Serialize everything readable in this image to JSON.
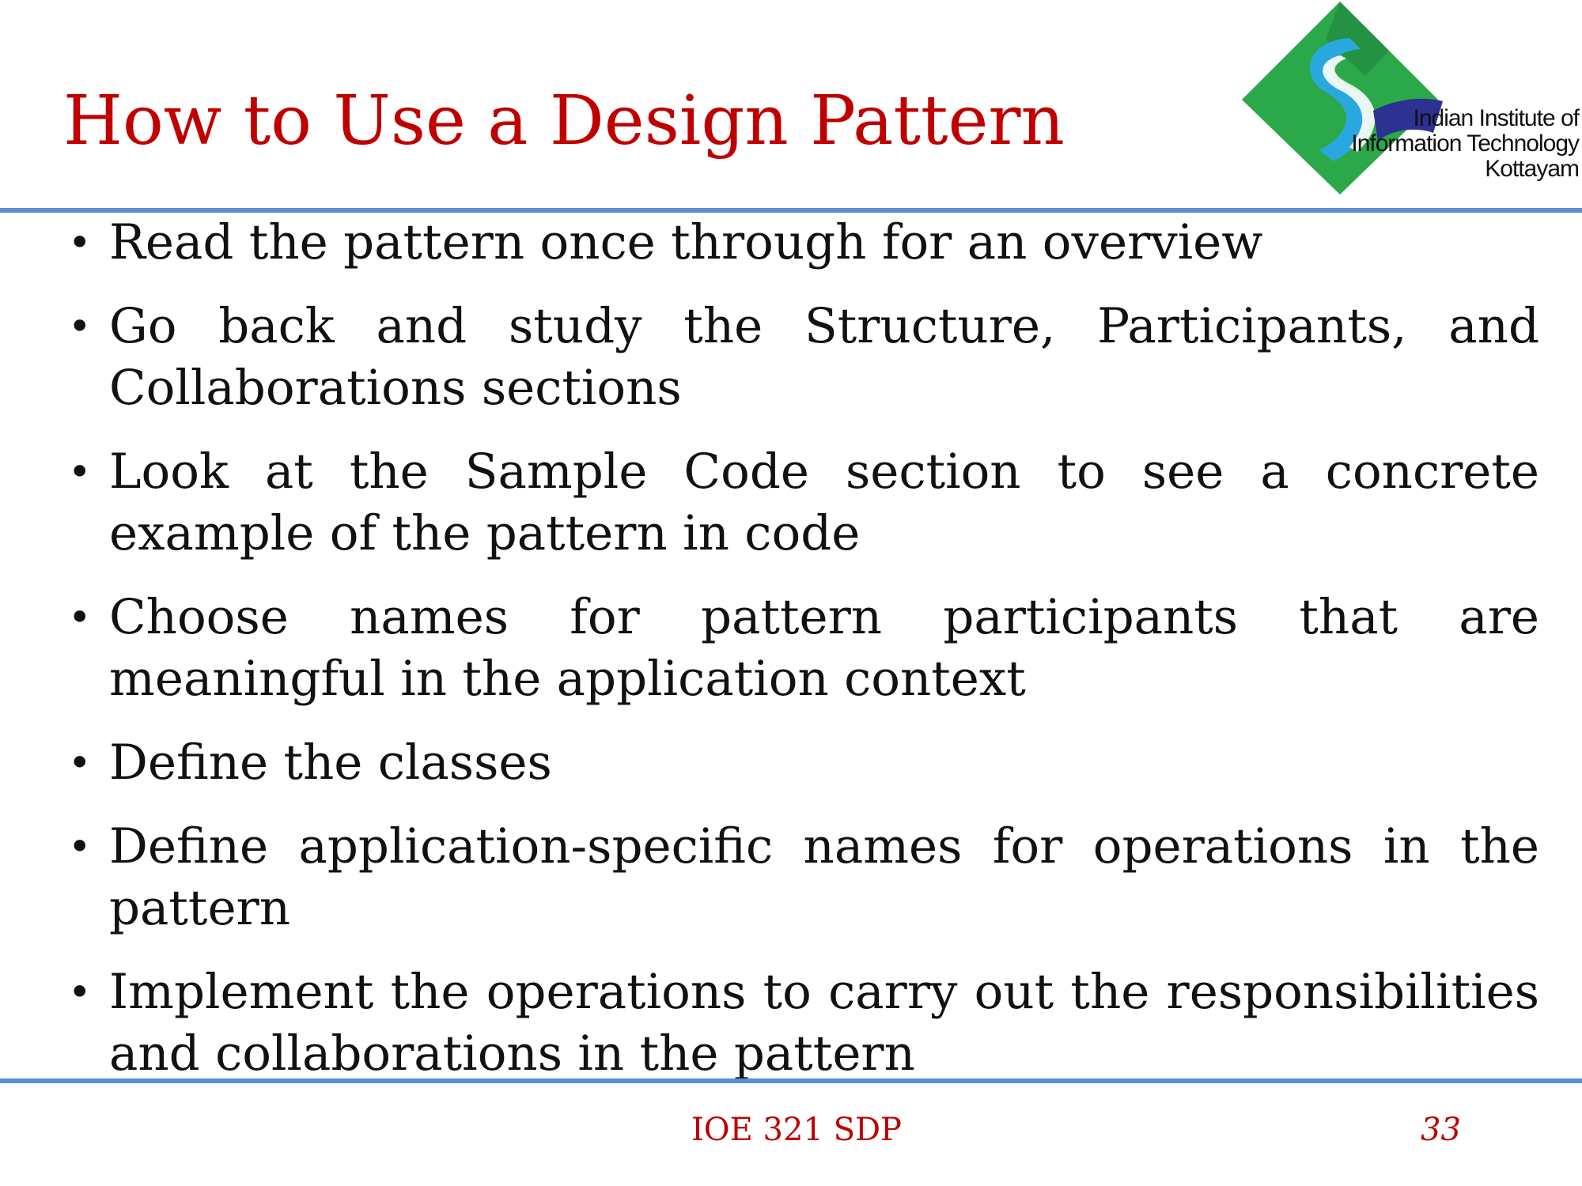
{
  "slide": {
    "title": "How to Use a Design Pattern",
    "logo": {
      "name": "iiit-kottayam-logo",
      "line1": "Indian Institute of",
      "line2": "Information Technology",
      "line3": "Kottayam"
    },
    "bullets": [
      "Read the pattern once through for an overview",
      "Go back and study the Structure, Participants, and Collaborations sections",
      "Look at the Sample Code section to see a concrete example of  the pattern in code",
      "Choose names for pattern participants that are meaningful in the application context",
      "Define the classes",
      "Define application-specific names for operations in the pattern",
      "Implement the operations to carry out the responsibilities and collaborations in the pattern"
    ],
    "footer": {
      "label": "IOE 321 SDP",
      "page_number": "33"
    }
  },
  "colors": {
    "title": "#c00000",
    "rule": "#5b8fcf",
    "logo_green": "#2aa84a",
    "logo_blue": "#29a8e0",
    "logo_navy": "#2e3192",
    "logo_dark_green": "#1e7f3a"
  }
}
